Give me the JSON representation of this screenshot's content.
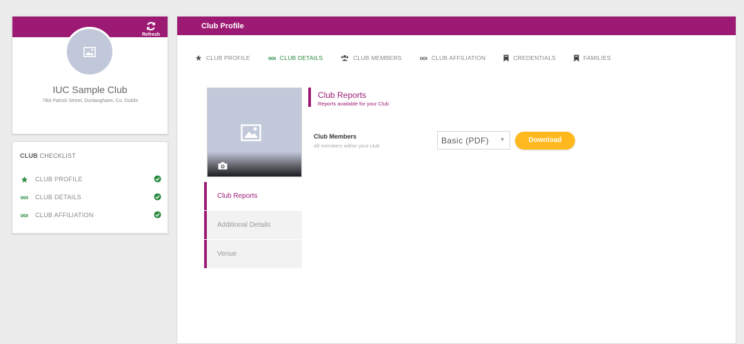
{
  "club": {
    "name": "IUC Sample Club",
    "address": "7BA Patrick Street, Dunlaoghaire, Co. Dublin",
    "refresh_label": "Refresh"
  },
  "checklist": {
    "title_bold": "CLUB",
    "title_rest": " CHECKLIST",
    "items": [
      {
        "label": "CLUB PROFILE",
        "icon": "star-icon",
        "done": true
      },
      {
        "label": "CLUB DETAILS",
        "icon": "details-icon",
        "icon_text": "ooı",
        "done": true
      },
      {
        "label": "CLUB AFFILIATION",
        "icon": "affiliation-icon",
        "icon_text": "ooı",
        "done": true
      }
    ]
  },
  "main": {
    "header_title": "Club Profile",
    "tabs": [
      {
        "label": "CLUB PROFILE",
        "icon": "star-icon",
        "active": false
      },
      {
        "label": "CLUB DETAILS",
        "icon": "details-icon",
        "icon_text": "ooı",
        "active": true
      },
      {
        "label": "CLUB MEMBERS",
        "icon": "members-icon",
        "active": false
      },
      {
        "label": "CLUB AFFILIATION",
        "icon": "affiliation-icon",
        "icon_text": "ooı",
        "active": false
      },
      {
        "label": "CREDENTIALS",
        "icon": "bookmark-icon",
        "active": false
      },
      {
        "label": "FAMILIES",
        "icon": "bookmark-icon",
        "active": false
      }
    ],
    "sub_nav": [
      {
        "label": "Club Reports",
        "active": true
      },
      {
        "label": "Additional Details",
        "active": false
      },
      {
        "label": "Venue",
        "active": false
      }
    ],
    "section": {
      "title": "Club Reports",
      "subtitle": "Reports available for your Club"
    },
    "report": {
      "label": "Club Members",
      "description": "All members within your club",
      "select_value": "Basic (PDF)",
      "download_label": "Download"
    }
  },
  "colors": {
    "brand": "#9c1a73",
    "accent": "#ffb91f",
    "success": "#2a8a3e"
  }
}
